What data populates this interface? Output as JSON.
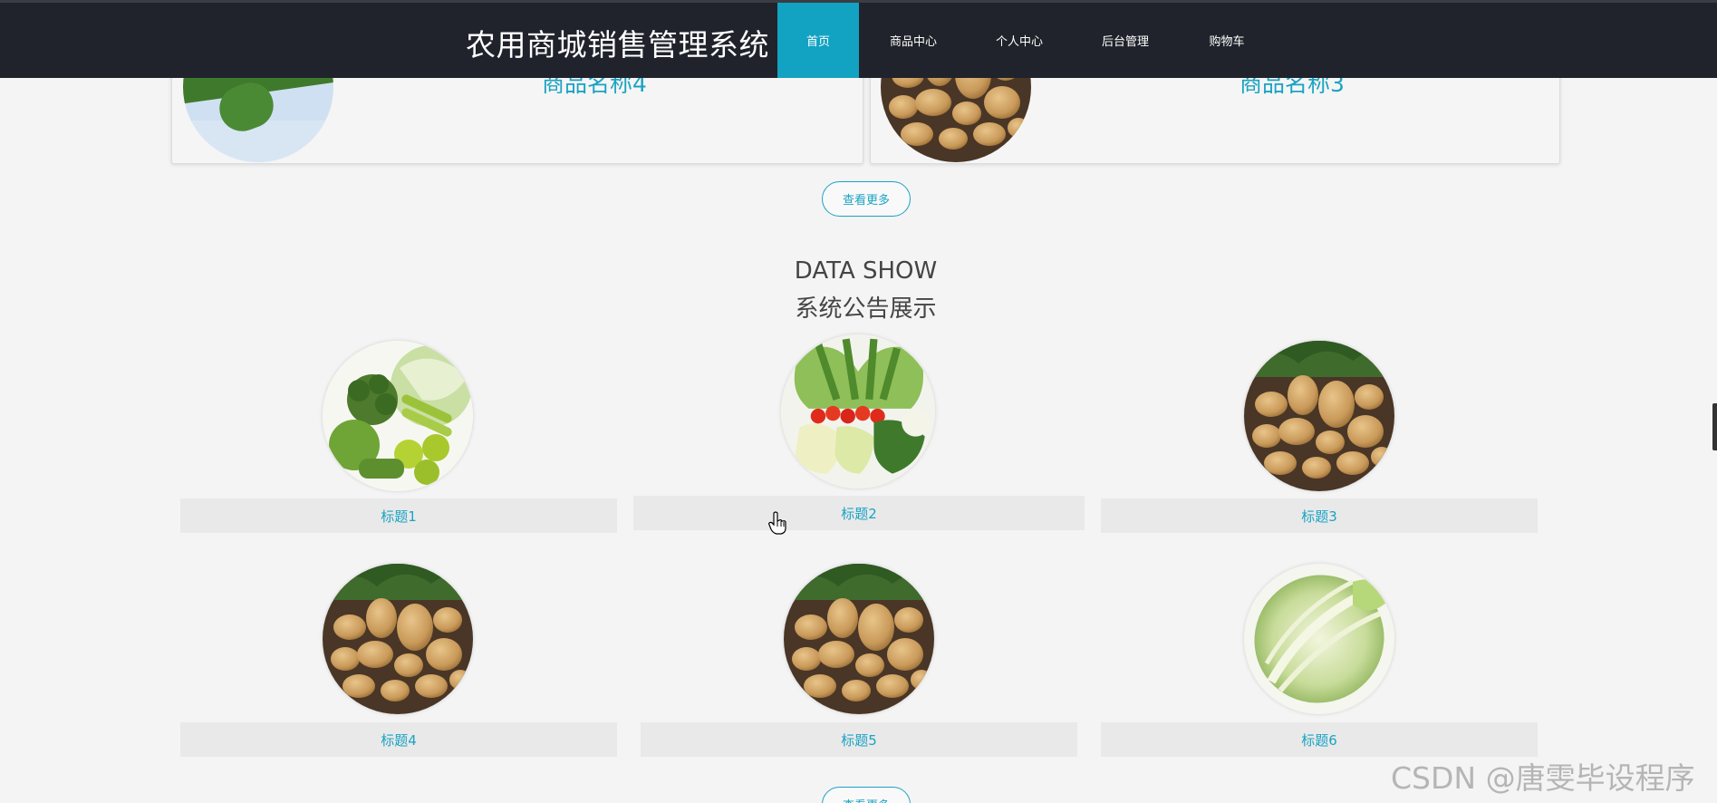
{
  "header": {
    "site_title": "农用商城销售管理系统",
    "nav": [
      {
        "label": "首页",
        "active": true
      },
      {
        "label": "商品中心",
        "active": false
      },
      {
        "label": "个人中心",
        "active": false
      },
      {
        "label": "后台管理",
        "active": false
      },
      {
        "label": "购物车",
        "active": false
      }
    ]
  },
  "products": {
    "items": [
      {
        "name": "商品名称4",
        "image": "cucumber"
      },
      {
        "name": "商品名称3",
        "image": "potatoes"
      }
    ],
    "more_label": "查看更多"
  },
  "notices": {
    "title_en": "DATA SHOW",
    "title_cn": "系统公告展示",
    "items": [
      {
        "title": "标题1",
        "image": "mixed-vegetables"
      },
      {
        "title": "标题2",
        "image": "vegetable-bundle"
      },
      {
        "title": "标题3",
        "image": "potatoes"
      },
      {
        "title": "标题4",
        "image": "potatoes"
      },
      {
        "title": "标题5",
        "image": "potatoes"
      },
      {
        "title": "标题6",
        "image": "chinese-cabbage"
      }
    ],
    "more_label": "查看更多"
  },
  "watermark": "CSDN @唐雯毕设程序",
  "colors": {
    "accent": "#12a2c2",
    "nav_bg": "#20232b",
    "page_bg": "#f4f4f4"
  }
}
